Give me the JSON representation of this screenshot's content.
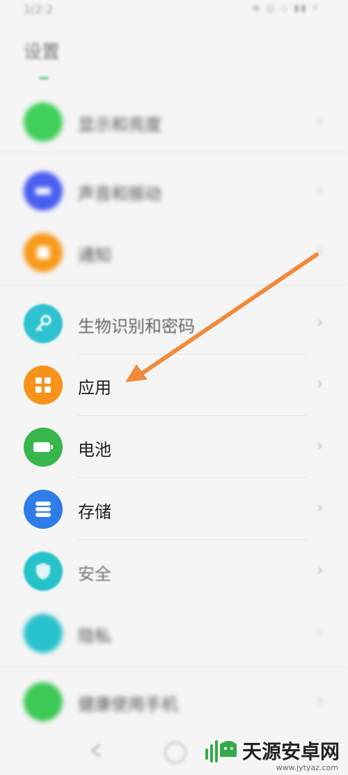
{
  "status_bar": {
    "time": "1(2:2",
    "right": "⊕ ◎ ◇ ▮▮ ⚡"
  },
  "page_title": "设置",
  "items": [
    {
      "label": "显示和亮度",
      "color": "#3fcf5a",
      "icon": "display-icon",
      "blurred": true
    },
    {
      "label": "声音和振动",
      "color": "#4a5ef0",
      "icon": "sound-icon",
      "blurred": true
    },
    {
      "label": "通知",
      "color": "#f79a1c",
      "icon": "bell-icon",
      "blurred": true
    },
    {
      "label": "生物识别和密码",
      "color": "#2ec1cf",
      "icon": "key-icon",
      "blurred": false
    },
    {
      "label": "应用",
      "color": "#f7931a",
      "icon": "apps-grid-icon",
      "blurred": false
    },
    {
      "label": "电池",
      "color": "#37b64b",
      "icon": "battery-icon",
      "blurred": false
    },
    {
      "label": "存储",
      "color": "#2f7de8",
      "icon": "storage-icon",
      "blurred": false
    },
    {
      "label": "安全",
      "color": "#26c2c9",
      "icon": "shield-icon",
      "blurred": false
    },
    {
      "label": "隐私",
      "color": "#28c2cc",
      "icon": "privacy-icon",
      "blurred": true
    },
    {
      "label": "健康使用手机",
      "color": "#3dc955",
      "icon": "hourglass-icon",
      "blurred": true
    }
  ],
  "chevron": "›",
  "watermark": {
    "text": "天源安卓网",
    "url": "www.jytyaz.com"
  },
  "arrow_color": "#f08a3c"
}
